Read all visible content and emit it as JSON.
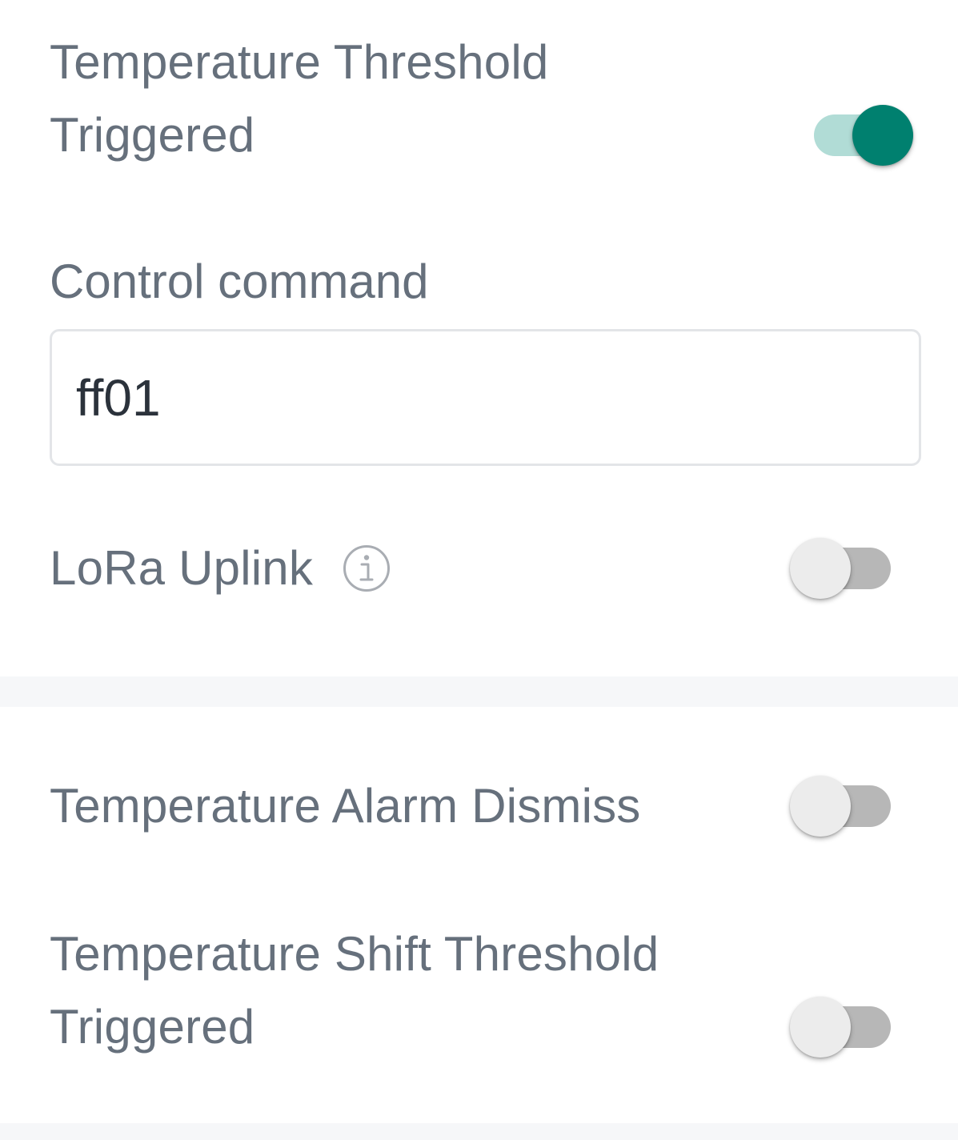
{
  "settings": {
    "temp_threshold_triggered": {
      "label_line1": "Temperature Threshold",
      "label_line2": "Triggered",
      "enabled": true
    },
    "control_command": {
      "label": "Control command",
      "value": "ff01"
    },
    "lora_uplink": {
      "label": "LoRa Uplink",
      "icon": "info-icon",
      "enabled": false
    },
    "temp_alarm_dismiss": {
      "label": "Temperature Alarm Dismiss",
      "enabled": false
    },
    "temp_shift_threshold_triggered": {
      "label_line1": "Temperature Shift Threshold",
      "label_line2": "Triggered",
      "enabled": false
    }
  },
  "colors": {
    "accent": "#00806f",
    "accent_track": "#b1dcd6",
    "off_track": "#b7b7b7",
    "off_knob": "#ececec",
    "label_text": "#66707c",
    "divider": "#f6f7f9"
  }
}
